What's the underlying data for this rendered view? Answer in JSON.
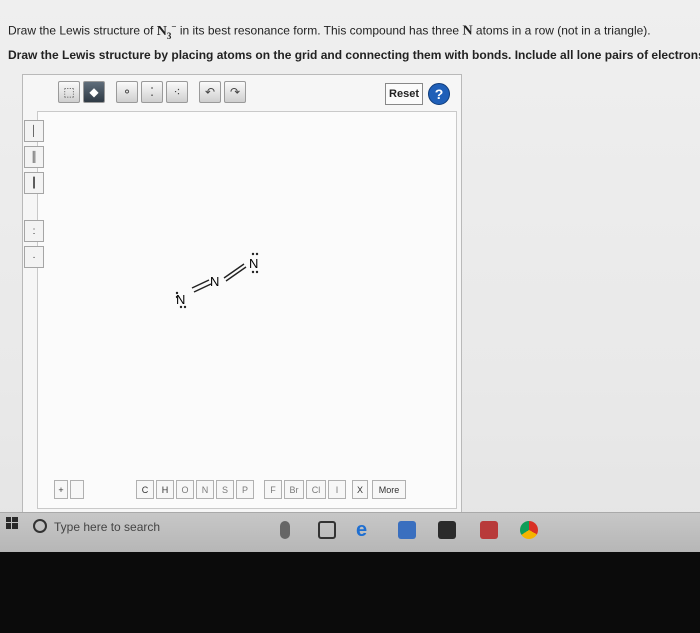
{
  "question": {
    "line1_prefix": "Draw the Lewis structure of ",
    "formula_base": "N",
    "formula_sub": "3",
    "formula_sup": "−",
    "line1_middle": " in its best resonance form. This compound has three ",
    "atom_symbol": "N",
    "line1_suffix": " atoms in a row (not in a triangle).",
    "line2": "Draw the Lewis structure by placing atoms on the grid and connecting them with bonds. Include all lone pairs of electrons."
  },
  "editor": {
    "reset_label": "Reset",
    "help_label": "?",
    "molecule_atoms": [
      "N",
      "N",
      "N"
    ],
    "element_buttons": [
      "C",
      "H",
      "O",
      "N",
      "S",
      "P",
      "F",
      "Br",
      "Cl",
      "I",
      "X"
    ],
    "more_label": "More",
    "plus_label": "+"
  },
  "taskbar": {
    "search_placeholder": "Type here to search"
  },
  "icons": {
    "windows": "windows-logo-icon",
    "search": "cortana-circle-icon",
    "edge": "edge-icon",
    "chrome": "chrome-icon"
  }
}
